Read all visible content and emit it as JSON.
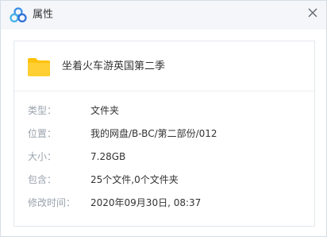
{
  "window": {
    "title": "属性"
  },
  "colors": {
    "logo_blue": "#3a8ee6",
    "folder_yellow": "#ffc20e",
    "label_gray": "#9aa3ad"
  },
  "icons": {
    "app": "baidu-netdisk-logo-icon",
    "close": "close-icon",
    "item": "folder-icon"
  },
  "file": {
    "name": "坐着火车游英国第二季"
  },
  "properties": [
    {
      "label": "类型：",
      "value": "文件夹"
    },
    {
      "label": "位置：",
      "value": "我的网盘/B-BC/第二部份/012"
    },
    {
      "label": "大小：",
      "value": "7.28GB"
    },
    {
      "label": "包含：",
      "value": "25个文件,0个文件夹"
    },
    {
      "label": "修改时间：",
      "value": "2020年09月30日, 08:37"
    }
  ]
}
